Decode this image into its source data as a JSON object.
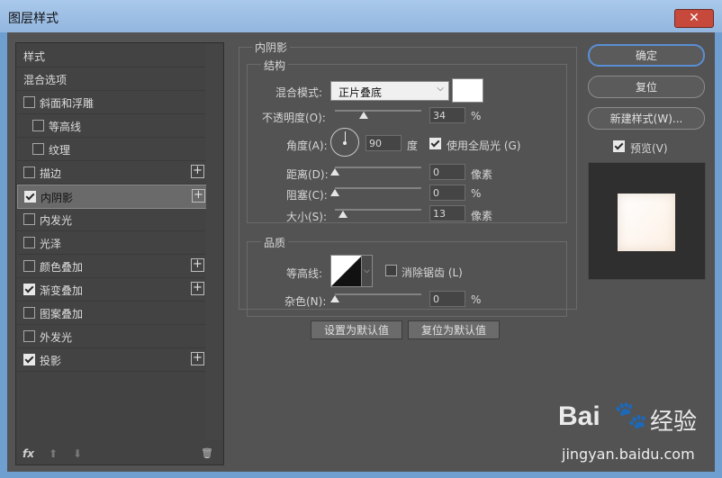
{
  "window": {
    "title": "图层样式",
    "close_glyph": "✕"
  },
  "left_panel": {
    "header_items": [
      {
        "label": "样式"
      },
      {
        "label": "混合选项"
      }
    ],
    "items": [
      {
        "label": "斜面和浮雕",
        "checked": false,
        "has_plus": false
      },
      {
        "label": "等高线",
        "checked": false,
        "has_plus": false
      },
      {
        "label": "纹理",
        "checked": false,
        "has_plus": false
      },
      {
        "label": "描边",
        "checked": false,
        "has_plus": true
      },
      {
        "label": "内阴影",
        "checked": true,
        "has_plus": true
      },
      {
        "label": "内发光",
        "checked": false,
        "has_plus": false
      },
      {
        "label": "光泽",
        "checked": false,
        "has_plus": false
      },
      {
        "label": "颜色叠加",
        "checked": false,
        "has_plus": true
      },
      {
        "label": "渐变叠加",
        "checked": true,
        "has_plus": true
      },
      {
        "label": "图案叠加",
        "checked": false,
        "has_plus": false
      },
      {
        "label": "外发光",
        "checked": false,
        "has_plus": false
      },
      {
        "label": "投影",
        "checked": true,
        "has_plus": true
      }
    ],
    "footer": {
      "fx": "fx",
      "up": "⬆",
      "down": "⬇",
      "trash": "🗑"
    }
  },
  "inner_shadow": {
    "section_title": "内阴影",
    "structure_title": "结构",
    "blend_mode_label": "混合模式:",
    "blend_mode_value": "正片叠底",
    "color_swatch": "#ffffff",
    "opacity_label": "不透明度(O):",
    "opacity_value": "34",
    "opacity_unit": "%",
    "angle_label": "角度(A):",
    "angle_value": "90",
    "angle_unit": "度",
    "global_light_label": "使用全局光 (G)",
    "distance_label": "距离(D):",
    "distance_value": "0",
    "distance_unit": "像素",
    "choke_label": "阻塞(C):",
    "choke_value": "0",
    "choke_unit": "%",
    "size_label": "大小(S):",
    "size_value": "13",
    "size_unit": "像素",
    "quality_title": "品质",
    "contour_label": "等高线:",
    "antialias_label": "消除锯齿 (L)",
    "noise_label": "杂色(N):",
    "noise_value": "0",
    "noise_unit": "%",
    "make_default": "设置为默认值",
    "reset_default": "复位为默认值"
  },
  "right_panel": {
    "ok": "确定",
    "reset": "复位",
    "new_style": "新建样式(W)...",
    "preview_label": "预览(V)"
  },
  "watermark": {
    "brand": "Bai",
    "paw": "🐾",
    "jingyan": "经验",
    "url": "jingyan.baidu.com"
  }
}
